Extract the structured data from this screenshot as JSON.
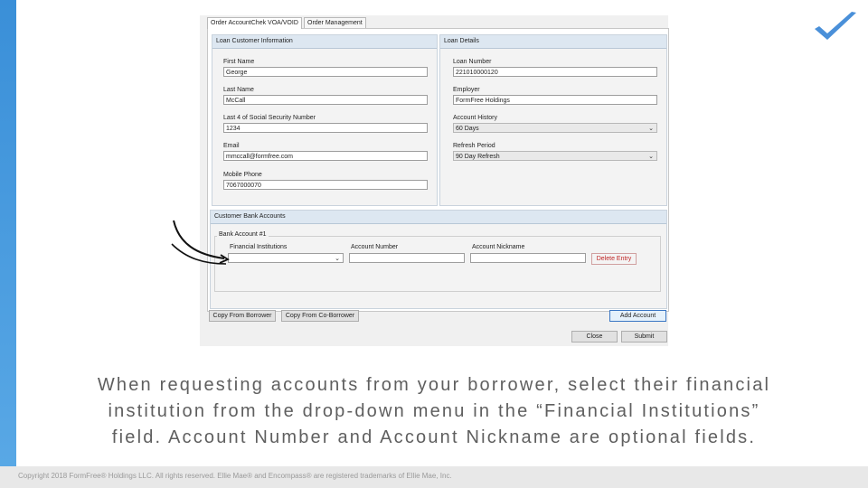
{
  "tabs": [
    {
      "label": "Order AccountChek VOA/VOID"
    },
    {
      "label": "Order Management"
    }
  ],
  "loan_customer": {
    "header": "Loan Customer Information",
    "first_name_label": "First Name",
    "first_name": "George",
    "last_name_label": "Last Name",
    "last_name": "McCall",
    "ssn_label": "Last 4 of Social Security Number",
    "ssn": "1234",
    "email_label": "Email",
    "email": "mmccall@formfree.com",
    "phone_label": "Mobile Phone",
    "phone": "7067000070"
  },
  "loan_details": {
    "header": "Loan Details",
    "loan_number_label": "Loan Number",
    "loan_number": "221010000120",
    "employer_label": "Employer",
    "employer": "FormFree Holdings",
    "account_history_label": "Account History",
    "account_history": "60 Days",
    "refresh_period_label": "Refresh Period",
    "refresh_period": "90 Day Refresh"
  },
  "bank_accounts": {
    "header": "Customer Bank Accounts",
    "account_title": "Bank Account #1",
    "institution_label": "Financial Institutions",
    "institution_value": "",
    "account_number_label": "Account Number",
    "account_number": "",
    "nickname_label": "Account Nickname",
    "nickname": "",
    "delete_label": "Delete Entry"
  },
  "buttons": {
    "copy_borrower": "Copy From Borrower",
    "copy_coborrower": "Copy From Co-Borrower",
    "add_account": "Add Account",
    "close": "Close",
    "submit": "Submit"
  },
  "caption": {
    "line1": "When requesting accounts from your borrower, select their financial",
    "line2": "institution from the drop-down menu in the “Financial Institutions”",
    "line3": "field. Account Number and Account Nickname are optional fields."
  },
  "footer": {
    "copyright": "Copyright 2018 FormFree® Holdings LLC. All rights reserved. Ellie Mae® and Encompass® are registered trademarks of Ellie Mae, Inc."
  },
  "colors": {
    "accent": "#3a8fd8",
    "check": "#4a90d9",
    "header_bg": "#dde7f1"
  }
}
